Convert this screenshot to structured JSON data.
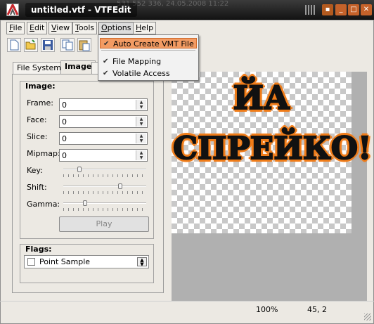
{
  "window": {
    "title": "untitled.vtf - VTFEdit",
    "background_text": "531 552 336, 24.05.2008 11:22"
  },
  "menubar": {
    "items": [
      "File",
      "Edit",
      "View",
      "Tools",
      "Options",
      "Help"
    ]
  },
  "options_menu": {
    "items": [
      {
        "label": "Auto Create VMT File",
        "checked": true,
        "highlighted": true
      },
      {
        "label": "File Mapping",
        "checked": true
      },
      {
        "label": "Volatile Access",
        "checked": true
      }
    ]
  },
  "tabs": [
    "File System",
    "Image"
  ],
  "image_group": {
    "title": "Image:",
    "fields": [
      {
        "label": "Frame:",
        "value": "0"
      },
      {
        "label": "Face:",
        "value": "0"
      },
      {
        "label": "Slice:",
        "value": "0"
      },
      {
        "label": "Mipmap:",
        "value": "0"
      }
    ],
    "sliders": [
      {
        "label": "Key:",
        "level": 0.18
      },
      {
        "label": "Shift:",
        "level": 0.7
      },
      {
        "label": "Gamma:",
        "level": 0.25
      }
    ],
    "play_label": "Play"
  },
  "flags_group": {
    "title": "Flags:",
    "selected": "Point Sample",
    "checked": false
  },
  "preview": {
    "line1": "ЙА",
    "line2": "СПРЕЙКО!",
    "text_color": "#111111",
    "outline_color": "#f07d1a"
  },
  "status": {
    "zoom": "100%",
    "coords": "45, 2"
  },
  "icons": [
    "new-icon",
    "open-icon",
    "save-icon",
    "copy-icon",
    "paste-icon"
  ]
}
